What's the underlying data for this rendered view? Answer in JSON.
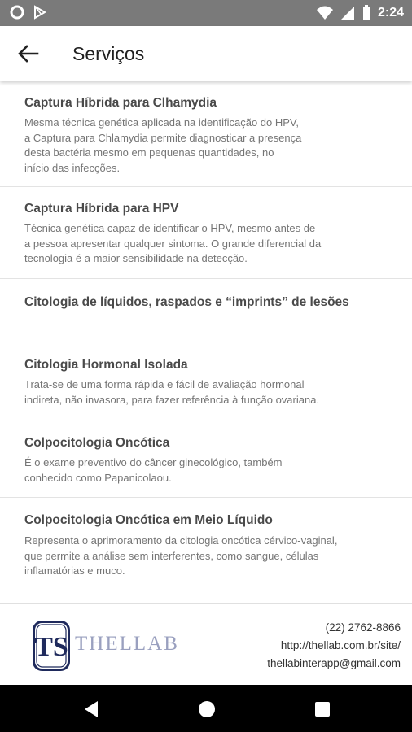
{
  "status_bar": {
    "time": "2:24",
    "icons": [
      "circle-notification-icon",
      "play-store-icon",
      "wifi-icon",
      "signal-icon",
      "battery-icon"
    ]
  },
  "app_bar": {
    "back_icon": "arrow-left-icon",
    "title": "Serviços"
  },
  "services": [
    {
      "title": "Captura Híbrida para Clhamydia",
      "description_lines": [
        "Mesma técnica genética aplicada na identificação do HPV,",
        "a Captura para Chlamydia permite diagnosticar a presença",
        "desta bactéria mesmo em pequenas quantidades, no",
        "início das infecções."
      ]
    },
    {
      "title": "Captura Híbrida para HPV",
      "description_lines": [
        "Técnica genética capaz de identificar o HPV, mesmo antes de",
        "a pessoa apresentar qualquer sintoma. O grande diferencial da",
        "tecnologia é a maior sensibilidade na detecção."
      ]
    },
    {
      "title": "Citologia de líquidos, raspados e “imprints” de lesões",
      "description_lines": []
    },
    {
      "title": "Citologia Hormonal Isolada",
      "description_lines": [
        "Trata-se de uma forma rápida e fácil de avaliação hormonal",
        "indireta, não invasora, para fazer referência à função ovariana."
      ]
    },
    {
      "title": "Colpocitologia Oncótica",
      "description_lines": [
        "É o exame preventivo do câncer ginecológico, também",
        "conhecido como Papanicolaou."
      ]
    },
    {
      "title": "Colpocitologia Oncótica em Meio Líquido",
      "description_lines": [
        "Representa o aprimoramento da citologia oncótica cérvico-vaginal,",
        "que permite a análise sem interferentes, como sangue, células",
        "inflamatórias e muco."
      ]
    }
  ],
  "footer": {
    "logo_text": "THELLAB",
    "logo_monogram": "TS",
    "phone": "(22) 2762-8866",
    "website": "http://thellab.com.br/site/",
    "email": "thellabinterapp@gmail.com"
  },
  "nav_bar": {
    "icons": [
      "back-triangle-icon",
      "home-circle-icon",
      "recents-square-icon"
    ]
  },
  "colors": {
    "status_bar": "#7a7a7a",
    "title_text": "#4a4a4a",
    "description_text": "#757575",
    "logo_navy": "#1f2a5c",
    "logo_text": "#9aa0bf"
  }
}
